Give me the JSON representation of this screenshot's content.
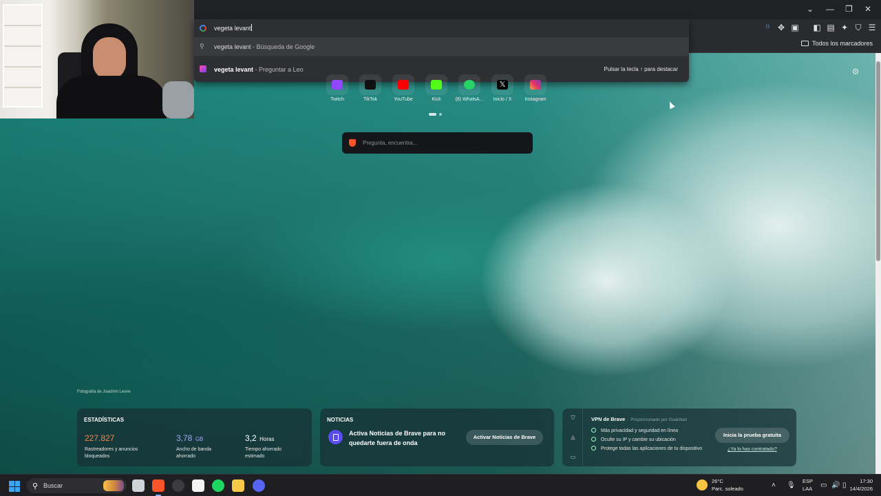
{
  "omnibox": {
    "query": "vegeta levant",
    "suggestions": [
      {
        "bold": "vegeta levant",
        "rest": " - Búsqueda de Google",
        "icon": "search-icon"
      },
      {
        "bold": "vegeta levant",
        "rest": " - Preguntar a Leo",
        "icon": "leo-icon",
        "hint": "Pulsar la tecla ↑ para destacar"
      }
    ]
  },
  "bookmarks": {
    "all_label": "Todos los marcadores"
  },
  "top_sites": [
    {
      "label": "Twitch",
      "color": "#9146ff"
    },
    {
      "label": "TikTok",
      "color": "#111111"
    },
    {
      "label": "YouTube",
      "color": "#ff0000"
    },
    {
      "label": "Kick",
      "color": "#53fc18"
    },
    {
      "label": "(8) WhatsA...",
      "color": "#25d366"
    },
    {
      "label": "Inicio / X",
      "color": "#000000"
    },
    {
      "label": "Instagram",
      "color": "#e1306c"
    }
  ],
  "search": {
    "placeholder": "Pregunta, encuentra..."
  },
  "photo_credit": "Fotografía de Joachim Lesne",
  "stats": {
    "title": "ESTADÍSTICAS",
    "items": [
      {
        "value": "227.827",
        "unit": "",
        "desc": "Rastreadores y anuncios bloqueados",
        "color": "#f0874e"
      },
      {
        "value": "3,78",
        "unit": "GB",
        "desc": "Ancho de banda ahorrado",
        "color": "#a5a6ff"
      },
      {
        "value": "3,2",
        "unit": "Horas",
        "desc": "Tiempo ahorrado estimado",
        "color": "#ffffff"
      }
    ]
  },
  "news": {
    "title": "NOTICIAS",
    "text": "Activa Noticias de Brave para no quedarte fuera de onda",
    "button": "Activar Noticias de Brave"
  },
  "vpn": {
    "title": "VPN de Brave",
    "provider": "Proporcionado por Guardian",
    "features": [
      "Más privacidad y seguridad en línea",
      "Oculte su IP y cambie su ubicación",
      "Protege todas las aplicaciones de tu dispositivo"
    ],
    "cta": "Inicia la prueba gratuita",
    "link": "¿Ya lo has contratado?"
  },
  "taskbar": {
    "search_label": "Buscar",
    "weather_temp": "26°C",
    "weather_desc": "Parc. soleado",
    "lang_1": "ESP",
    "lang_2": "LAA",
    "time": "17:30",
    "date": "14/4/2026"
  }
}
